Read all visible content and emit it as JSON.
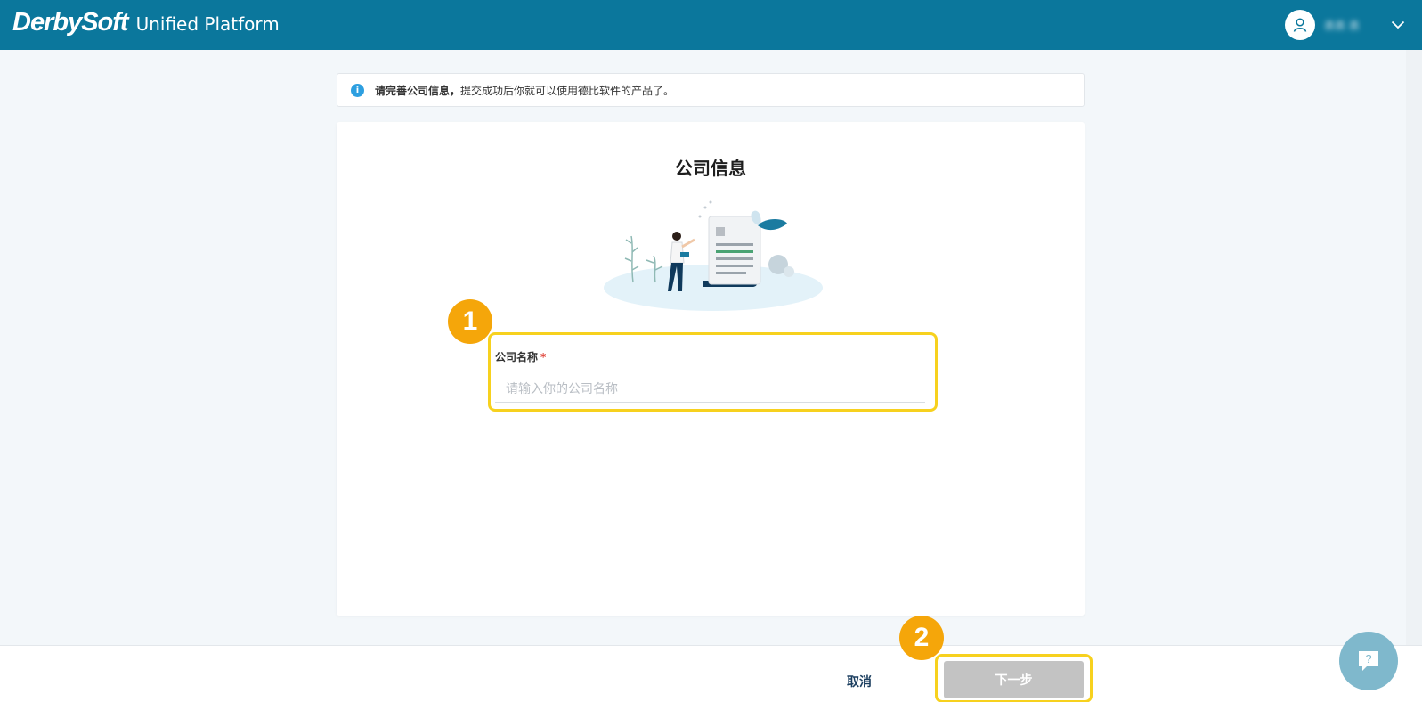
{
  "header": {
    "brand": "DerbySoft",
    "product": "Unified Platform",
    "user_name": "表表 表",
    "avatar_icon": "user-icon",
    "menu_icon": "chevron-down-icon"
  },
  "notice": {
    "icon": "info-icon",
    "bold_text": "请完善公司信息，",
    "text": "提交成功后你就可以使用德比软件的产品了。"
  },
  "card": {
    "title": "公司信息",
    "field": {
      "label": "公司名称",
      "required_mark": "*",
      "value": "",
      "placeholder": "请输入你的公司名称"
    }
  },
  "annotations": {
    "badge_1": "1",
    "badge_2": "2",
    "highlight_color": "#f7d11e",
    "badge_color": "#f5a60a"
  },
  "footer": {
    "cancel_label": "取消",
    "next_label": "下一步"
  },
  "help": {
    "icon": "help-chat-icon",
    "glyph": "?"
  },
  "colors": {
    "header_bg": "#0b779c",
    "next_disabled": "#c3c3c3",
    "info": "#2d9fe0"
  }
}
